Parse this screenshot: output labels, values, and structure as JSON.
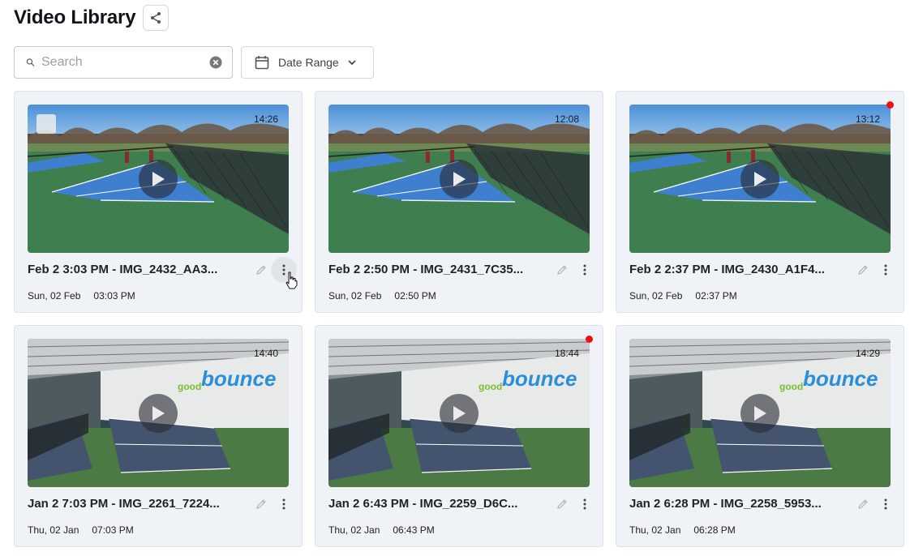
{
  "header": {
    "title": "Video Library",
    "share_icon": "share-icon"
  },
  "search": {
    "placeholder": "Search",
    "value": ""
  },
  "date_filter": {
    "label": "Date Range"
  },
  "videos": [
    {
      "title": "Feb 2 3:03 PM - IMG_2432_AA3...",
      "date": "Sun, 02 Feb",
      "time": "03:03 PM",
      "duration": "14:26",
      "scene": "outdoor",
      "selectable": true,
      "new_dot": false
    },
    {
      "title": "Feb 2 2:50 PM - IMG_2431_7C35...",
      "date": "Sun, 02 Feb",
      "time": "02:50 PM",
      "duration": "12:08",
      "scene": "outdoor",
      "selectable": false,
      "new_dot": false
    },
    {
      "title": "Feb 2 2:37 PM - IMG_2430_A1F4...",
      "date": "Sun, 02 Feb",
      "time": "02:37 PM",
      "duration": "13:12",
      "scene": "outdoor",
      "selectable": false,
      "new_dot": true
    },
    {
      "title": "Jan 2 7:03 PM - IMG_2261_7224...",
      "date": "Thu, 02 Jan",
      "time": "07:03 PM",
      "duration": "14:40",
      "scene": "indoor",
      "selectable": false,
      "new_dot": false
    },
    {
      "title": "Jan 2 6:43 PM - IMG_2259_D6C...",
      "date": "Thu, 02 Jan",
      "time": "06:43 PM",
      "duration": "18:44",
      "scene": "indoor",
      "selectable": false,
      "new_dot": true
    },
    {
      "title": "Jan 2 6:28 PM - IMG_2258_5953...",
      "date": "Thu, 02 Jan",
      "time": "06:28 PM",
      "duration": "14:29",
      "scene": "indoor",
      "selectable": false,
      "new_dot": false
    }
  ],
  "indoor_brand": {
    "prefix": "good",
    "suffix": "bounce"
  },
  "colors": {
    "accent_blue": "#2a8fd6",
    "unread_dot": "#ee1111",
    "court_blue": "#3f7fd0",
    "court_green": "#3f7f4f"
  }
}
